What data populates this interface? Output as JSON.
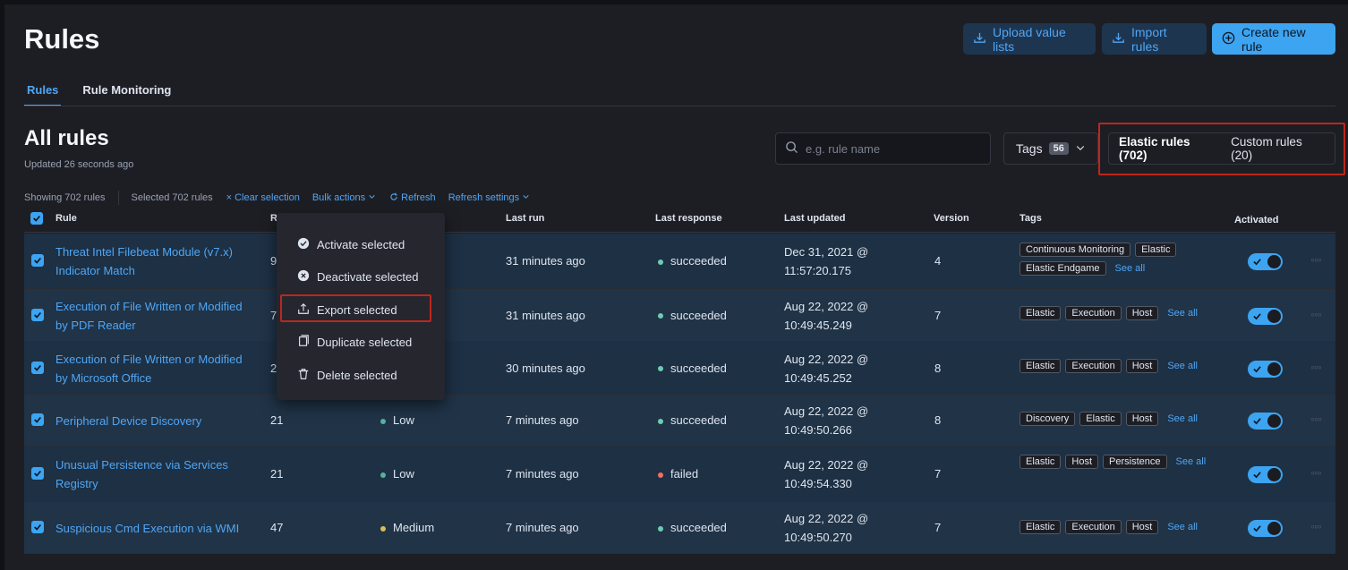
{
  "header": {
    "title": "Rules",
    "upload_label": "Upload value lists",
    "import_label": "Import rules",
    "create_label": "Create new rule"
  },
  "tabs": [
    {
      "label": "Rules",
      "active": true
    },
    {
      "label": "Rule Monitoring",
      "active": false
    }
  ],
  "section": {
    "title": "All rules",
    "updated": "Updated 26 seconds ago"
  },
  "search": {
    "placeholder": "e.g. rule name"
  },
  "tags_filter": {
    "label": "Tags",
    "count": "56"
  },
  "rule_filter": {
    "elastic": "Elastic rules (702)",
    "custom": "Custom rules (20)"
  },
  "utility": {
    "showing": "Showing 702 rules",
    "selected": "Selected 702 rules",
    "clear": "Clear selection",
    "bulk": "Bulk actions",
    "refresh": "Refresh",
    "refresh_settings": "Refresh settings"
  },
  "columns": {
    "rule": "Rule",
    "risk": "R",
    "last_run": "Last run",
    "last_response": "Last response",
    "last_updated": "Last updated",
    "version": "Version",
    "tags": "Tags",
    "activated": "Activated"
  },
  "bulk_menu": [
    {
      "label": "Activate selected",
      "icon": "check-circle-icon"
    },
    {
      "label": "Deactivate selected",
      "icon": "cross-circle-icon"
    },
    {
      "label": "Export selected",
      "icon": "export-icon"
    },
    {
      "label": "Duplicate selected",
      "icon": "copy-icon"
    },
    {
      "label": "Delete selected",
      "icon": "trash-icon"
    }
  ],
  "rows": [
    {
      "name1": "Threat Intel Filebeat Module (v7.x)",
      "name2": "Indicator Match",
      "risk": "9",
      "severity": "",
      "last_run": "31 minutes ago",
      "response": "succeeded",
      "updated1": "Dec 31, 2021 @",
      "updated2": "11:57:20.175",
      "version": "4",
      "tags": [
        "Continuous Monitoring",
        "Elastic",
        "Elastic Endgame"
      ],
      "see_all": "See all"
    },
    {
      "name1": "Execution of File Written or Modified",
      "name2": "by PDF Reader",
      "risk": "7",
      "severity": "",
      "last_run": "31 minutes ago",
      "response": "succeeded",
      "updated1": "Aug 22, 2022 @",
      "updated2": "10:49:45.249",
      "version": "7",
      "tags": [
        "Elastic",
        "Execution",
        "Host"
      ],
      "see_all": "See all"
    },
    {
      "name1": "Execution of File Written or Modified",
      "name2": "by Microsoft Office",
      "risk": "2",
      "severity": "",
      "last_run": "30 minutes ago",
      "response": "succeeded",
      "updated1": "Aug 22, 2022 @",
      "updated2": "10:49:45.252",
      "version": "8",
      "tags": [
        "Elastic",
        "Execution",
        "Host"
      ],
      "see_all": "See all"
    },
    {
      "name1": "Peripheral Device Discovery",
      "name2": "",
      "risk": "21",
      "severity": "Low",
      "last_run": "7 minutes ago",
      "response": "succeeded",
      "updated1": "Aug 22, 2022 @",
      "updated2": "10:49:50.266",
      "version": "8",
      "tags": [
        "Discovery",
        "Elastic",
        "Host"
      ],
      "see_all": "See all"
    },
    {
      "name1": "Unusual Persistence via Services",
      "name2": "Registry",
      "risk": "21",
      "severity": "Low",
      "last_run": "7 minutes ago",
      "response": "failed",
      "updated1": "Aug 22, 2022 @",
      "updated2": "10:49:54.330",
      "version": "7",
      "tags": [
        "Elastic",
        "Host",
        "Persistence"
      ],
      "see_all": "See all"
    },
    {
      "name1": "Suspicious Cmd Execution via WMI",
      "name2": "",
      "risk": "47",
      "severity": "Medium",
      "last_run": "7 minutes ago",
      "response": "succeeded",
      "updated1": "Aug 22, 2022 @",
      "updated2": "10:49:50.270",
      "version": "7",
      "tags": [
        "Elastic",
        "Execution",
        "Host"
      ],
      "see_all": "See all"
    }
  ],
  "colors": {
    "accent": "#3da4f1",
    "succeeded": "#6dccb1",
    "failed": "#f86b63",
    "low": "#54b399",
    "medium": "#d6bf57",
    "highlight": "#bd271e"
  }
}
